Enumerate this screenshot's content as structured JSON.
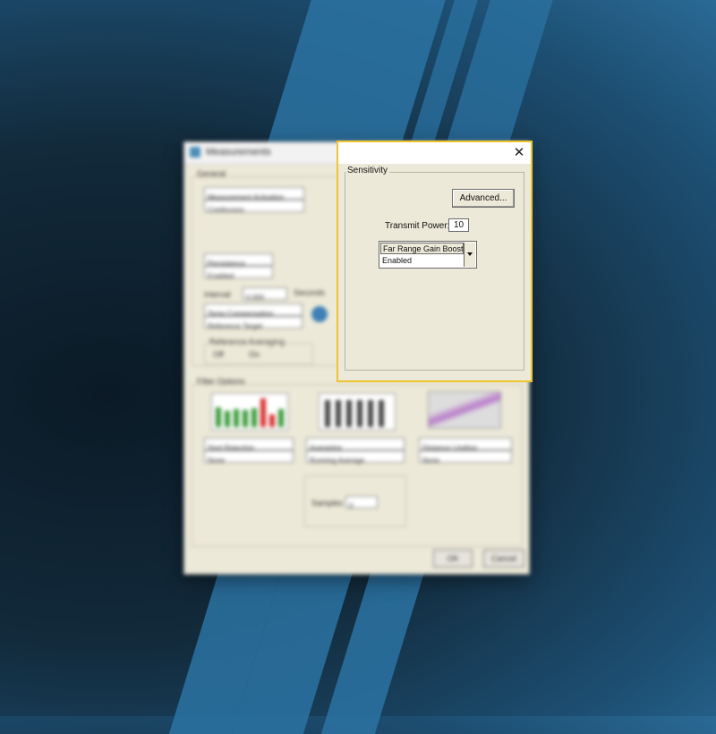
{
  "background_window": {
    "title": "Measurements",
    "general_group": "General",
    "measurement_activation_label": "Measurement Activation",
    "measurement_activation_value": "Continuous",
    "persistence_label": "Persistence",
    "persistence_value": "Enabled",
    "interval_label": "Interval",
    "interval_value": "0.000",
    "interval_unit": "Seconds",
    "temp_comp_label": "Temp Compensation",
    "temp_comp_value": "Reference Target",
    "ref_avg_group": "Reference Averaging",
    "ref_avg_off": "Off",
    "ref_avg_on": "On",
    "filter_group": "Filter Options",
    "filter1_label": "Spot Rejection",
    "filter1_value": "None",
    "filter2_label": "Averaging",
    "filter2_value": "Running Average",
    "filter3_label": "Distance Limiting",
    "filter3_value": "None",
    "samples_label": "Samples",
    "samples_value": "0",
    "ok_label": "OK",
    "cancel_label": "Cancel"
  },
  "dialog": {
    "close_symbol": "✕",
    "group_title": "Sensitivity",
    "advanced_label": "Advanced...",
    "transmit_power_label": "Transmit Power:",
    "transmit_power_value": "10",
    "gain_boost_label": "Far Range Gain Boost:",
    "gain_boost_value": "Enabled"
  },
  "colors": {
    "dialog_highlight": "#f0c42e",
    "window_face": "#ece9d8",
    "stripe_blue": "#2b73a3"
  }
}
